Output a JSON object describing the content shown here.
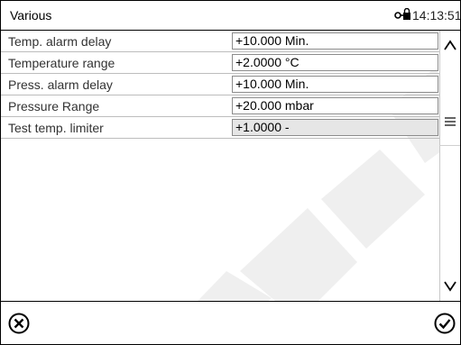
{
  "window": {
    "title": "Various",
    "clock": "14:13:51"
  },
  "params": [
    {
      "label": "Temp. alarm delay",
      "value": "+10.000 Min.",
      "disabled": false
    },
    {
      "label": "Temperature range",
      "value": "+2.0000 °C",
      "disabled": false
    },
    {
      "label": "Press. alarm delay",
      "value": "+10.000 Min.",
      "disabled": false
    },
    {
      "label": "Pressure Range",
      "value": "+20.000 mbar",
      "disabled": false
    },
    {
      "label": "Test temp. limiter",
      "value": "+1.0000 -",
      "disabled": true
    }
  ],
  "icons": {
    "lock": "lock-key-icon",
    "scroll_up": "chevron-up-icon",
    "scroll_grip": "grip-lines-icon",
    "scroll_down": "chevron-down-icon",
    "cancel": "circle-x-icon",
    "confirm": "circle-check-icon"
  },
  "colors": {
    "watermark": "#f0f0f0",
    "disabled_field": "#e6e6e6",
    "row_divider": "#bdbdbd"
  }
}
